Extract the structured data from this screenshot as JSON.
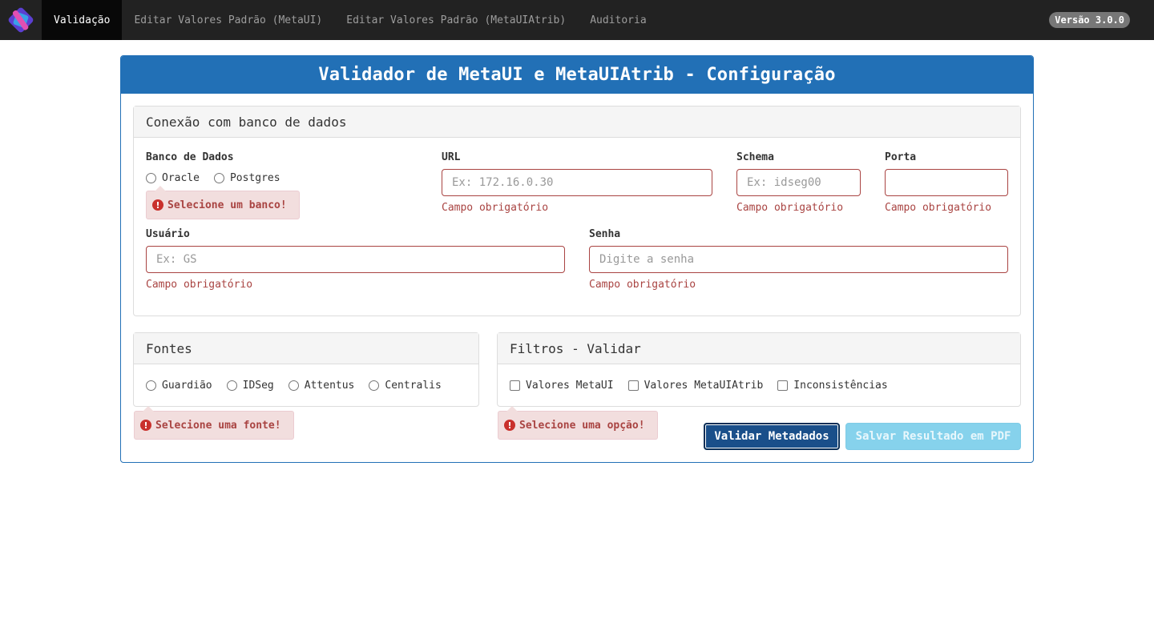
{
  "nav": {
    "items": [
      {
        "label": "Validação",
        "active": true
      },
      {
        "label": "Editar Valores Padrão (MetaUI)",
        "active": false
      },
      {
        "label": "Editar Valores Padrão (MetaUIAtrib)",
        "active": false
      },
      {
        "label": "Auditoria",
        "active": false
      }
    ],
    "version": "Versão 3.0.0"
  },
  "main": {
    "title": "Validador de MetaUI e MetaUIAtrib - Configuração"
  },
  "connection": {
    "heading": "Conexão com banco de dados",
    "database": {
      "label": "Banco de Dados",
      "options": [
        "Oracle",
        "Postgres"
      ],
      "error": "Selecione um banco!"
    },
    "url": {
      "label": "URL",
      "placeholder": "Ex: 172.16.0.30",
      "value": "",
      "error": "Campo obrigatório"
    },
    "schema": {
      "label": "Schema",
      "placeholder": "Ex: idseg00",
      "value": "",
      "error": "Campo obrigatório"
    },
    "port": {
      "label": "Porta",
      "placeholder": "",
      "value": "",
      "error": "Campo obrigatório"
    },
    "user": {
      "label": "Usuário",
      "placeholder": "Ex: GS",
      "value": "",
      "error": "Campo obrigatório"
    },
    "password": {
      "label": "Senha",
      "placeholder": "Digite a senha",
      "value": "",
      "error": "Campo obrigatório"
    }
  },
  "sources": {
    "heading": "Fontes",
    "options": [
      "Guardião",
      "IDSeg",
      "Attentus",
      "Centralis"
    ],
    "error": "Selecione uma fonte!"
  },
  "filters": {
    "heading": "Filtros - Validar",
    "options": [
      "Valores MetaUI",
      "Valores MetaUIAtrib",
      "Inconsistências"
    ],
    "error": "Selecione uma opção!"
  },
  "actions": {
    "validate": "Validar Metadados",
    "save_pdf": "Salvar Resultado em PDF"
  },
  "colors": {
    "navbar": "#222222",
    "primary": "#2270b6",
    "error": "#a94442",
    "error_bg": "#f2dede"
  }
}
